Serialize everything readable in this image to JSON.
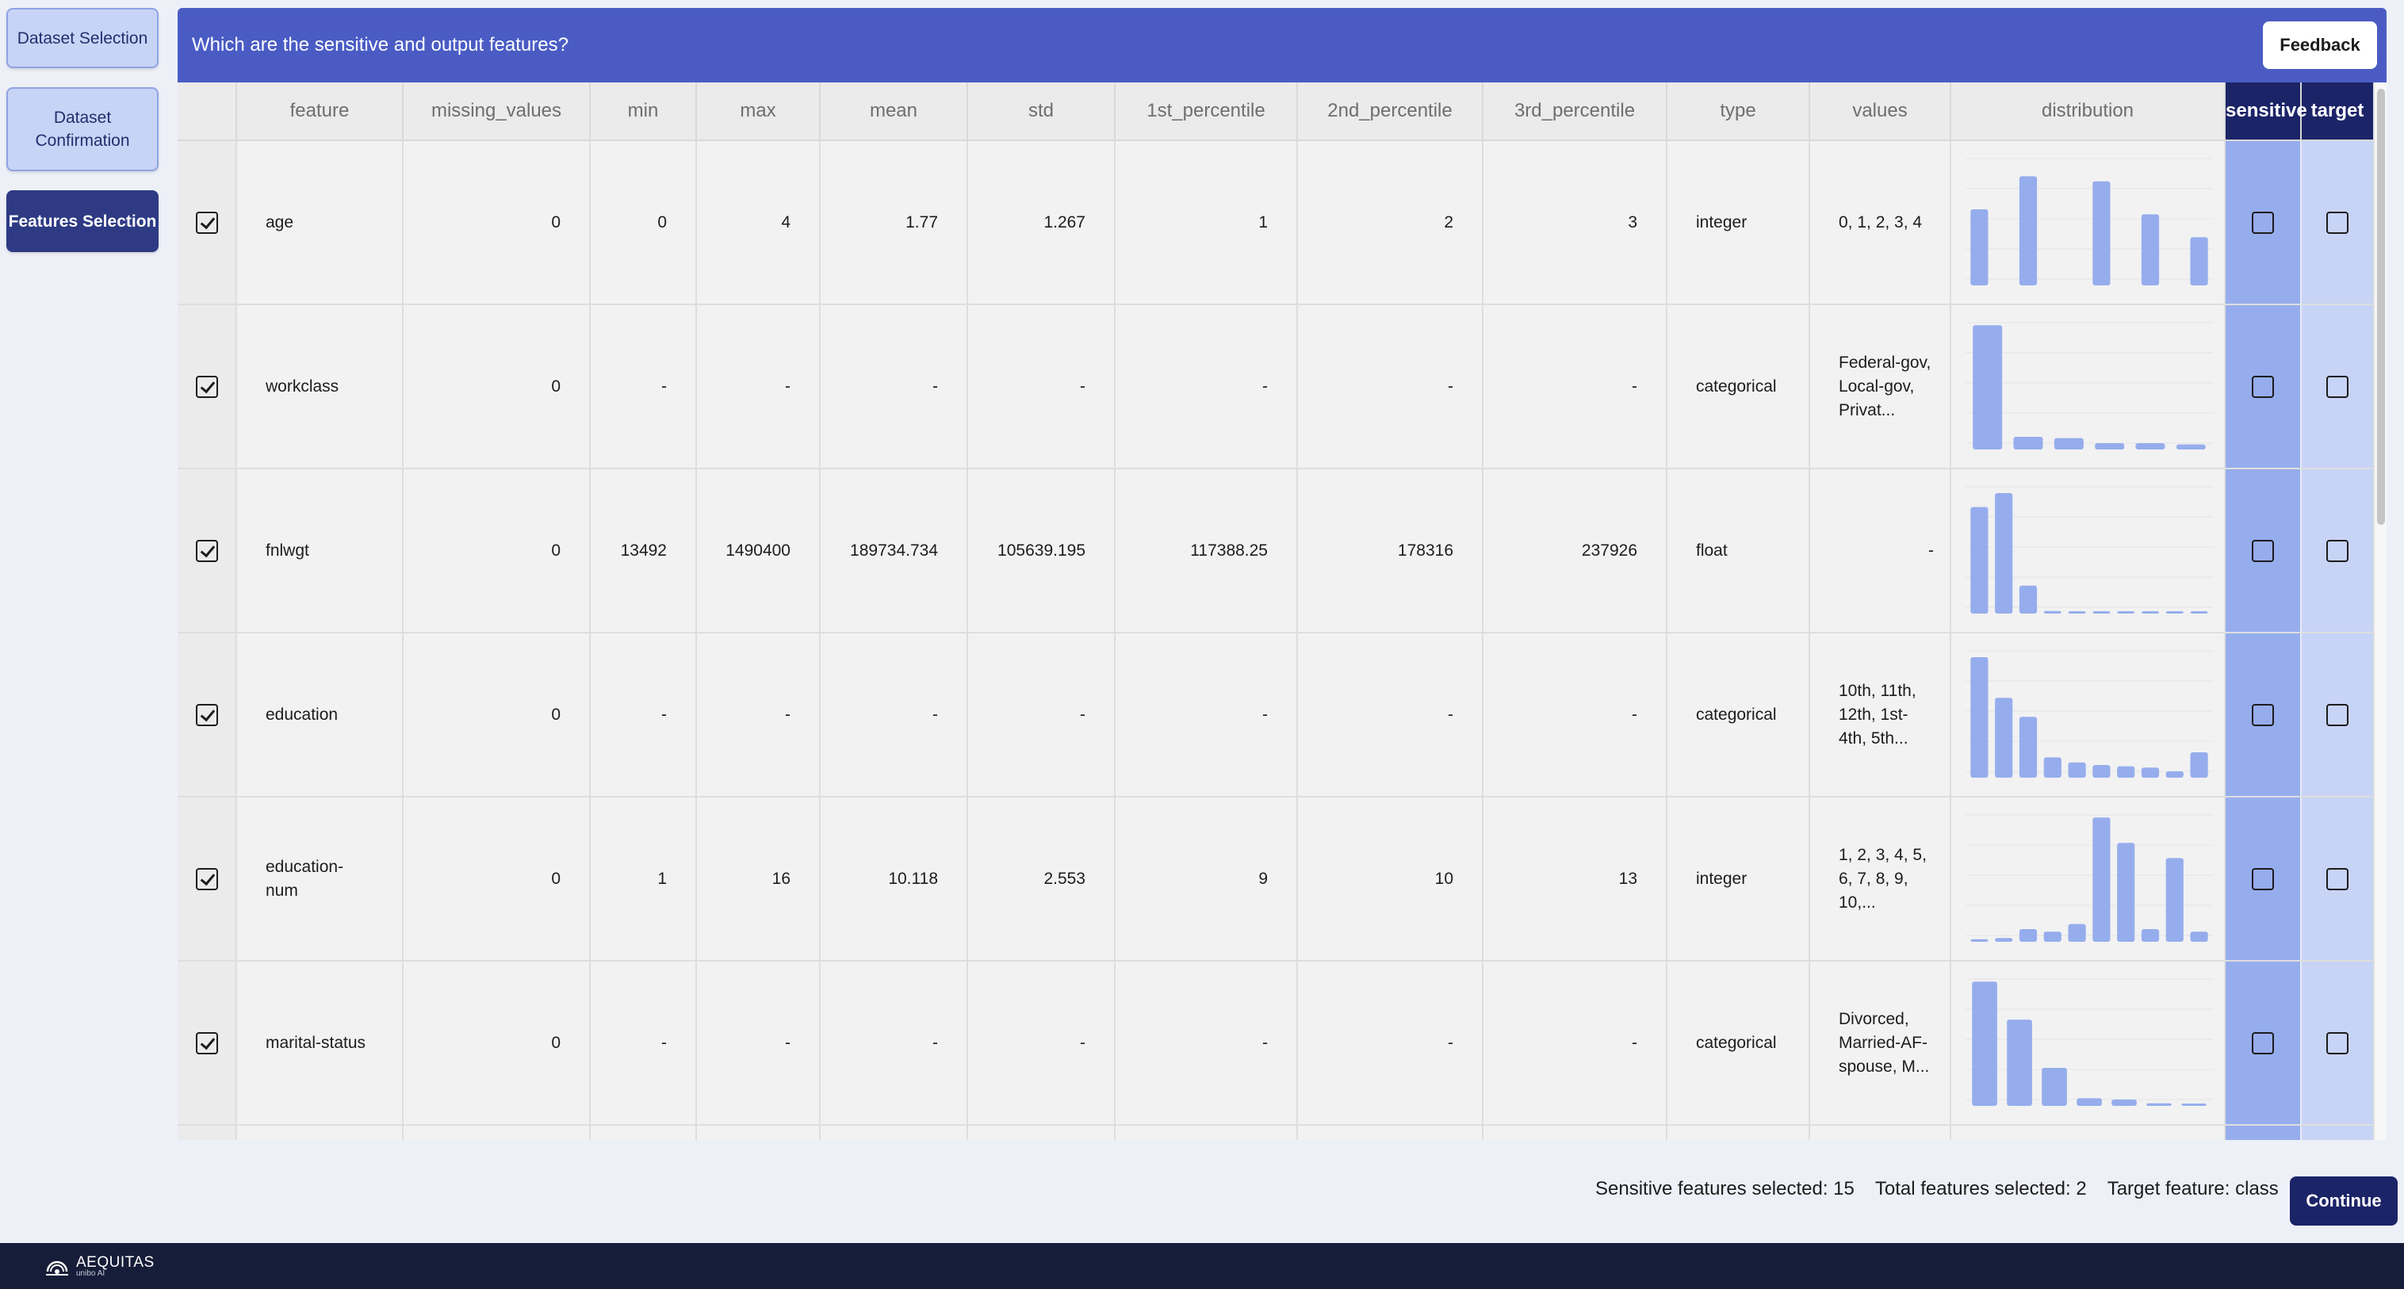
{
  "sidebar": {
    "items": [
      {
        "label": "Dataset Selection"
      },
      {
        "label": "Dataset Confirmation"
      },
      {
        "label": "Features Selection"
      }
    ]
  },
  "header": {
    "question": "Which are the sensitive and output features?",
    "feedback_label": "Feedback"
  },
  "table": {
    "columns": [
      "feature",
      "missing_values",
      "min",
      "max",
      "mean",
      "std",
      "1st_percentile",
      "2nd_percentile",
      "3rd_percentile",
      "type",
      "values",
      "distribution",
      "sensitive",
      "target"
    ],
    "rows": [
      {
        "feature": "age",
        "missing_values": "0",
        "min": "0",
        "max": "4",
        "mean": "1.77",
        "std": "1.267",
        "p1": "1",
        "p2": "2",
        "p3": "3",
        "type": "integer",
        "values": "0, 1, 2, 3, 4",
        "selected": true,
        "sensitive": false,
        "target": false,
        "distribution": [
          0.6,
          0,
          0.86,
          0,
          0,
          0.82,
          0,
          0.56,
          0,
          0.38
        ]
      },
      {
        "feature": "workclass",
        "missing_values": "0",
        "min": "-",
        "max": "-",
        "mean": "-",
        "std": "-",
        "p1": "-",
        "p2": "-",
        "p3": "-",
        "type": "categorical",
        "values": "Federal-gov, Local-gov, Privat...",
        "selected": true,
        "sensitive": false,
        "target": false,
        "distribution": [
          0.98,
          0.1,
          0.09,
          0.05,
          0.05,
          0.04
        ]
      },
      {
        "feature": "fnlwgt",
        "missing_values": "0",
        "min": "13492",
        "max": "1490400",
        "mean": "189734.734",
        "std": "105639.195",
        "p1": "117388.25",
        "p2": "178316",
        "p3": "237926",
        "type": "float",
        "values": "-",
        "selected": true,
        "sensitive": false,
        "target": false,
        "distribution": [
          0.84,
          0.95,
          0.22,
          0.02,
          0.01,
          0.01,
          0.005,
          0.005,
          0.005,
          0.005
        ]
      },
      {
        "feature": "education",
        "missing_values": "0",
        "min": "-",
        "max": "-",
        "mean": "-",
        "std": "-",
        "p1": "-",
        "p2": "-",
        "p3": "-",
        "type": "categorical",
        "values": "10th, 11th, 12th, 1st-4th, 5th...",
        "selected": true,
        "sensitive": false,
        "target": false,
        "distribution": [
          0.95,
          0.63,
          0.48,
          0.16,
          0.12,
          0.1,
          0.09,
          0.08,
          0.05,
          0.2
        ]
      },
      {
        "feature": "education-num",
        "missing_values": "0",
        "min": "1",
        "max": "16",
        "mean": "10.118",
        "std": "2.553",
        "p1": "9",
        "p2": "10",
        "p3": "13",
        "type": "integer",
        "values": "1, 2, 3, 4, 5, 6, 7, 8, 9, 10,...",
        "selected": true,
        "sensitive": false,
        "target": false,
        "distribution": [
          0.02,
          0.03,
          0.1,
          0.08,
          0.14,
          0.98,
          0.78,
          0.1,
          0.66,
          0.08
        ]
      },
      {
        "feature": "marital-status",
        "missing_values": "0",
        "min": "-",
        "max": "-",
        "mean": "-",
        "std": "-",
        "p1": "-",
        "p2": "-",
        "p3": "-",
        "type": "categorical",
        "values": "Divorced, Married-AF-spouse, M...",
        "selected": true,
        "sensitive": false,
        "target": false,
        "distribution": [
          0.98,
          0.68,
          0.3,
          0.06,
          0.05,
          0.02,
          0.01
        ]
      }
    ]
  },
  "status": {
    "sensitive_selected": "Sensitive features selected: 15",
    "total_selected": "Total features selected: 2",
    "target_feature": "Target feature: class"
  },
  "continue_label": "Continue",
  "logo": {
    "name": "AEQUITAS",
    "sub": "unibo AI"
  },
  "colors": {
    "header": "#4a5cc4",
    "dark_navy": "#1c2468",
    "bar": "#96aded",
    "sensitive_col": "#96aded",
    "target_col": "#c8d4f6"
  }
}
